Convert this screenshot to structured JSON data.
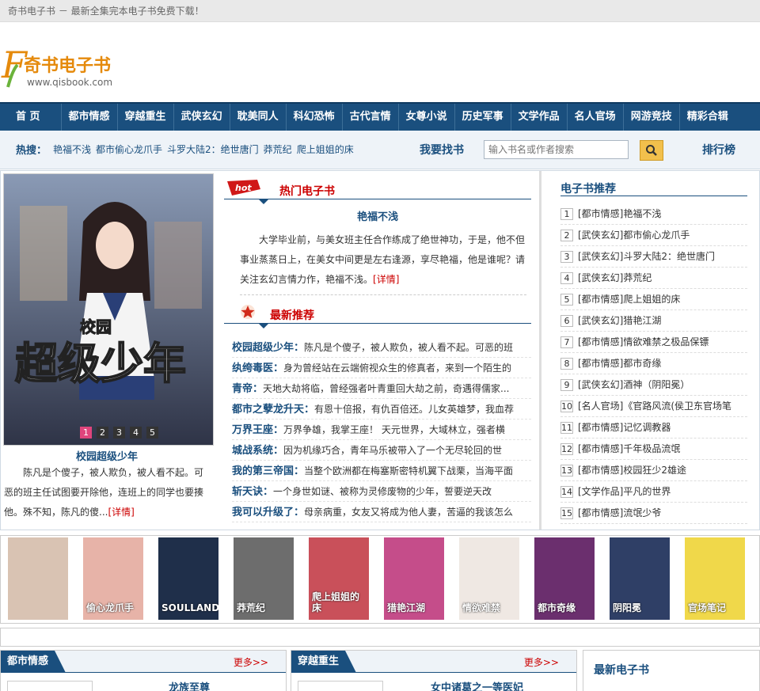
{
  "topbar": {
    "text": "奇书电子书 － 最新全集完本电子书免费下载！"
  },
  "logo": {
    "name": "奇书电子书",
    "url_text": "www.qisbook.com",
    "letter": "F"
  },
  "nav": [
    "首 页",
    "都市情感",
    "穿越重生",
    "武侠玄幻",
    "耽美同人",
    "科幻恐怖",
    "古代言情",
    "女尊小说",
    "历史军事",
    "文学作品",
    "名人官场",
    "网游竞技",
    "精彩合辑"
  ],
  "search": {
    "hot_label": "热搜：",
    "hot_links": [
      "艳福不浅",
      "都市偷心龙爪手",
      "斗罗大陆2：绝世唐门",
      "莽荒纪",
      "爬上姐姐的床"
    ],
    "find_label": "我要找书",
    "placeholder": "输入书名或作者搜索",
    "rank_label": "排行榜"
  },
  "feature": {
    "dots": [
      "1",
      "2",
      "3",
      "4",
      "5"
    ],
    "cover_text": "超级少年",
    "cover_small": "校园",
    "title": "校园超级少年",
    "desc": "陈凡是个傻子，被人欺负，被人看不起。可恶的班主任试图要开除他，连班上的同学也要揍他。殊不知，陈凡的傻...",
    "more": "[详情]"
  },
  "hot": {
    "badge": "hot",
    "title": "热门电子书",
    "book_title": "艳福不浅",
    "desc": "大学毕业前，与美女班主任合作练成了绝世神功，于是，他不但事业蒸蒸日上，在美女中间更是左右逢源，享尽艳福，他是谁呢？请关注玄幻言情力作，艳福不浅。",
    "more": "[详情]"
  },
  "recommend": {
    "title": "最新推荐",
    "items": [
      {
        "name": "校园超级少年：",
        "desc": "陈凡是个傻子，被人欺负，被人看不起。可恶的班"
      },
      {
        "name": "纨绔毒医：",
        "desc": "身为曾经站在云端俯视众生的修真者，来到一个陌生的"
      },
      {
        "name": "青帝：",
        "desc": "天地大劫将临，曾经强者叶青重回大劫之前，奇遇得儒家..."
      },
      {
        "name": "都市之孽龙升天：",
        "desc": "有恩十倍报，有仇百倍还。儿女英雄梦，我血荐"
      },
      {
        "name": "万界王座：",
        "desc": "万界争雄，我掌王座！  天元世界，大域林立，强者横"
      },
      {
        "name": "城战系统：",
        "desc": "因为机缘巧合，青年马乐被带入了一个无尽轮回的世"
      },
      {
        "name": "我的第三帝国：",
        "desc": "当整个欧洲都在梅塞斯密特机翼下战栗，当海平面"
      },
      {
        "name": "斩天诀：",
        "desc": "一个身世如谜、被称为灵修废物的少年，誓要逆天改"
      },
      {
        "name": "我可以升级了：",
        "desc": "母亲病重，女友又将成为他人妻，苦逼的我该怎么"
      }
    ]
  },
  "ranking": {
    "title": "电子书推荐",
    "items": [
      {
        "num": "1",
        "cat": "[都市情感]",
        "name": "艳福不浅"
      },
      {
        "num": "2",
        "cat": "[武侠玄幻]",
        "name": "都市偷心龙爪手"
      },
      {
        "num": "3",
        "cat": "[武侠玄幻]",
        "name": "斗罗大陆2：绝世唐门"
      },
      {
        "num": "4",
        "cat": "[武侠玄幻]",
        "name": "莽荒纪"
      },
      {
        "num": "5",
        "cat": "[都市情感]",
        "name": "爬上姐姐的床"
      },
      {
        "num": "6",
        "cat": "[武侠玄幻]",
        "name": "猎艳江湖"
      },
      {
        "num": "7",
        "cat": "[都市情感]",
        "name": "情欲难禁之极品保镖"
      },
      {
        "num": "8",
        "cat": "[都市情感]",
        "name": "都市奇缘"
      },
      {
        "num": "9",
        "cat": "[武侠玄幻]",
        "name": "酒神（阴阳冕）"
      },
      {
        "num": "10",
        "cat": "[名人官场]",
        "name": "《官路风流(侯卫东官场笔"
      },
      {
        "num": "11",
        "cat": "[都市情感]",
        "name": "记忆调教器"
      },
      {
        "num": "12",
        "cat": "[都市情感]",
        "name": "千年极品流氓"
      },
      {
        "num": "13",
        "cat": "[都市情感]",
        "name": "校园狂少2雄途"
      },
      {
        "num": "14",
        "cat": "[文学作品]",
        "name": "平凡的世界"
      },
      {
        "num": "15",
        "cat": "[都市情感]",
        "name": "流氓少爷"
      }
    ]
  },
  "covers": [
    {
      "text": "",
      "color": "#d9c3b3"
    },
    {
      "text": "偷心龙爪手",
      "color": "#e7b3a8"
    },
    {
      "text": "SOULLAND",
      "color": "#1f2f4a"
    },
    {
      "text": "莽荒纪",
      "color": "#6d6d6d"
    },
    {
      "text": "爬上姐姐的床",
      "color": "#c9505a"
    },
    {
      "text": "猎艳江湖",
      "color": "#c54d8a"
    },
    {
      "text": "情欲难禁",
      "color": "#efe8e3"
    },
    {
      "text": "都市奇缘",
      "color": "#6b2f6e"
    },
    {
      "text": "阴阳冕",
      "color": "#2f3f66"
    },
    {
      "text": "官场笔记",
      "color": "#f0d84a"
    }
  ],
  "panels": [
    {
      "tab": "都市情感",
      "more": "更多>>",
      "book": "龙族至尊"
    },
    {
      "tab": "穿越重生",
      "more": "更多>>",
      "book": "女中诸葛之一等医妃"
    }
  ],
  "latest": {
    "title": "最新电子书"
  },
  "colors": {
    "nav": "#1a4f7e",
    "accent": "#c00",
    "search_btn": "#f2c04c"
  }
}
